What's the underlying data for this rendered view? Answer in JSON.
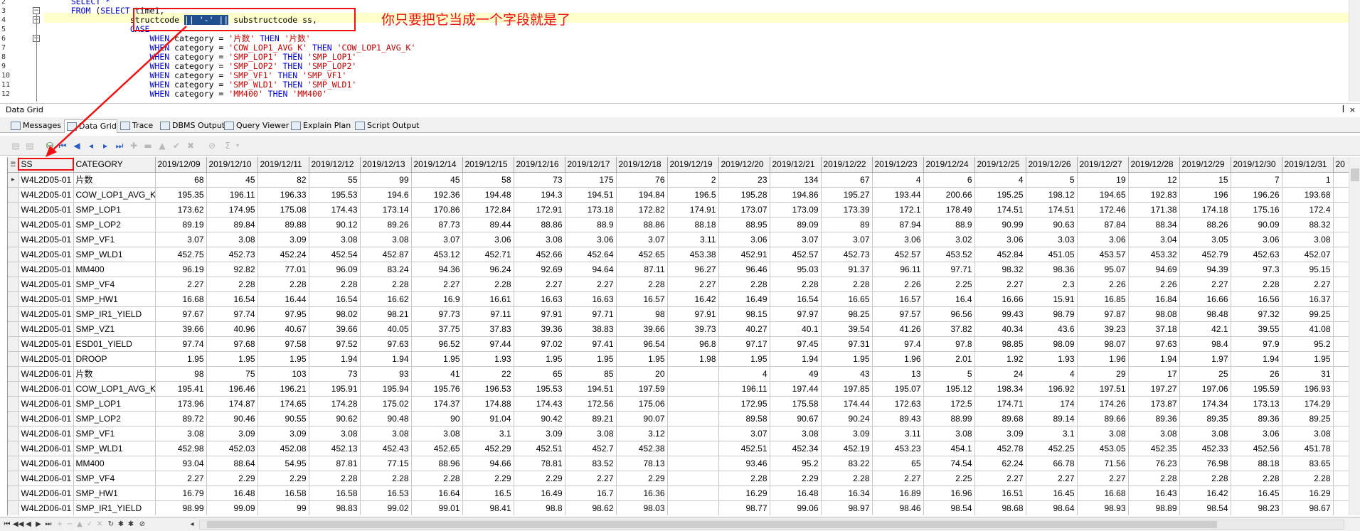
{
  "editor": {
    "lines": [
      "2",
      "3",
      "4",
      "5",
      "6",
      "7",
      "8",
      "9",
      "10",
      "11",
      "12"
    ],
    "code": [
      {
        "indent": "    ",
        "parts": [
          {
            "t": "SELECT *",
            "c": "kw"
          }
        ]
      },
      {
        "indent": "    ",
        "parts": [
          {
            "t": "FROM ",
            "c": "kw"
          },
          {
            "t": "(",
            "c": ""
          },
          {
            "t": "SELECT ",
            "c": "kw"
          },
          {
            "t": "time1,",
            "c": ""
          }
        ]
      },
      {
        "indent": "                ",
        "parts": [
          {
            "t": "structcode ",
            "c": ""
          },
          {
            "t": "|| '-' ||",
            "c": "sel"
          },
          {
            "t": " substructcode ss,",
            "c": ""
          }
        ]
      },
      {
        "indent": "                ",
        "parts": [
          {
            "t": "CASE",
            "c": "kw"
          }
        ]
      },
      {
        "indent": "                    ",
        "parts": [
          {
            "t": "WHEN ",
            "c": "kw"
          },
          {
            "t": "category = ",
            "c": ""
          },
          {
            "t": "'片数'",
            "c": "str"
          },
          {
            "t": " THEN ",
            "c": "kw"
          },
          {
            "t": "'片数'",
            "c": "str"
          }
        ]
      },
      {
        "indent": "                    ",
        "parts": [
          {
            "t": "WHEN ",
            "c": "kw"
          },
          {
            "t": "category = ",
            "c": ""
          },
          {
            "t": "'COW_LOP1_AVG_K'",
            "c": "str"
          },
          {
            "t": " THEN ",
            "c": "kw"
          },
          {
            "t": "'COW_LOP1_AVG_K'",
            "c": "str"
          }
        ]
      },
      {
        "indent": "                    ",
        "parts": [
          {
            "t": "WHEN ",
            "c": "kw"
          },
          {
            "t": "category = ",
            "c": ""
          },
          {
            "t": "'SMP_LOP1'",
            "c": "str"
          },
          {
            "t": " THEN ",
            "c": "kw"
          },
          {
            "t": "'SMP_LOP1'",
            "c": "str"
          }
        ]
      },
      {
        "indent": "                    ",
        "parts": [
          {
            "t": "WHEN ",
            "c": "kw"
          },
          {
            "t": "category = ",
            "c": ""
          },
          {
            "t": "'SMP_LOP2'",
            "c": "str"
          },
          {
            "t": " THEN ",
            "c": "kw"
          },
          {
            "t": "'SMP_LOP2'",
            "c": "str"
          }
        ]
      },
      {
        "indent": "                    ",
        "parts": [
          {
            "t": "WHEN ",
            "c": "kw"
          },
          {
            "t": "category = ",
            "c": ""
          },
          {
            "t": "'SMP_VF1'",
            "c": "str"
          },
          {
            "t": " THEN ",
            "c": "kw"
          },
          {
            "t": "'SMP_VF1'",
            "c": "str"
          }
        ]
      },
      {
        "indent": "                    ",
        "parts": [
          {
            "t": "WHEN ",
            "c": "kw"
          },
          {
            "t": "category = ",
            "c": ""
          },
          {
            "t": "'SMP_WLD1'",
            "c": "str"
          },
          {
            "t": " THEN ",
            "c": "kw"
          },
          {
            "t": "'SMP_WLD1'",
            "c": "str"
          }
        ]
      },
      {
        "indent": "                    ",
        "parts": [
          {
            "t": "WHEN ",
            "c": "kw"
          },
          {
            "t": "category = ",
            "c": ""
          },
          {
            "t": "'MM400'",
            "c": "str"
          },
          {
            "t": " THEN ",
            "c": "kw"
          },
          {
            "t": "'MM400'",
            "c": "str"
          }
        ]
      }
    ],
    "annotation": "你只要把它当成一个字段就是了"
  },
  "panel": {
    "title": "Data Grid",
    "pin": "ꟾ",
    "close": "×"
  },
  "tabs": [
    {
      "label": "Messages",
      "icon": "messages-icon"
    },
    {
      "label": "Data Grid",
      "icon": "grid-icon"
    },
    {
      "label": "Trace",
      "icon": "trace-icon"
    },
    {
      "label": "DBMS Output",
      "icon": "dbms-icon"
    },
    {
      "label": "Query Viewer",
      "icon": "query-icon"
    },
    {
      "label": "Explain Plan",
      "icon": "plan-icon"
    },
    {
      "label": "Script Output",
      "icon": "script-icon"
    }
  ],
  "grid": {
    "columns": [
      "SS",
      "CATEGORY",
      "2019/12/09",
      "2019/12/10",
      "2019/12/11",
      "2019/12/12",
      "2019/12/13",
      "2019/12/14",
      "2019/12/15",
      "2019/12/16",
      "2019/12/17",
      "2019/12/18",
      "2019/12/19",
      "2019/12/20",
      "2019/12/21",
      "2019/12/22",
      "2019/12/23",
      "2019/12/24",
      "2019/12/25",
      "2019/12/26",
      "2019/12/27",
      "2019/12/28",
      "2019/12/29",
      "2019/12/30",
      "2019/12/31",
      "20"
    ],
    "rows": [
      [
        "W4L2D05-01",
        "片数",
        "68",
        "45",
        "82",
        "55",
        "99",
        "45",
        "58",
        "73",
        "175",
        "76",
        "2",
        "23",
        "134",
        "67",
        "4",
        "6",
        "4",
        "5",
        "19",
        "12",
        "15",
        "7",
        "1",
        ""
      ],
      [
        "W4L2D05-01",
        "COW_LOP1_AVG_K",
        "195.35",
        "196.11",
        "196.33",
        "195.53",
        "194.6",
        "192.36",
        "194.48",
        "194.3",
        "194.51",
        "194.84",
        "196.5",
        "195.28",
        "194.86",
        "195.27",
        "193.44",
        "200.66",
        "195.25",
        "198.12",
        "194.65",
        "192.83",
        "196",
        "196.26",
        "193.68",
        ""
      ],
      [
        "W4L2D05-01",
        "SMP_LOP1",
        "173.62",
        "174.95",
        "175.08",
        "174.43",
        "173.14",
        "170.86",
        "172.84",
        "172.91",
        "173.18",
        "172.82",
        "174.91",
        "173.07",
        "173.09",
        "173.39",
        "172.1",
        "178.49",
        "174.51",
        "174.51",
        "172.46",
        "171.38",
        "174.18",
        "175.16",
        "172.4",
        ""
      ],
      [
        "W4L2D05-01",
        "SMP_LOP2",
        "89.19",
        "89.84",
        "89.88",
        "90.12",
        "89.26",
        "87.73",
        "89.44",
        "88.86",
        "88.9",
        "88.86",
        "88.18",
        "88.95",
        "89.09",
        "89",
        "87.94",
        "88.9",
        "90.99",
        "90.63",
        "87.84",
        "88.34",
        "88.26",
        "90.09",
        "88.32",
        ""
      ],
      [
        "W4L2D05-01",
        "SMP_VF1",
        "3.07",
        "3.08",
        "3.09",
        "3.08",
        "3.08",
        "3.07",
        "3.06",
        "3.08",
        "3.06",
        "3.07",
        "3.11",
        "3.06",
        "3.07",
        "3.07",
        "3.06",
        "3.02",
        "3.06",
        "3.03",
        "3.06",
        "3.04",
        "3.05",
        "3.06",
        "3.08",
        ""
      ],
      [
        "W4L2D05-01",
        "SMP_WLD1",
        "452.75",
        "452.73",
        "452.24",
        "452.54",
        "452.87",
        "453.12",
        "452.71",
        "452.66",
        "452.64",
        "452.65",
        "453.38",
        "452.91",
        "452.57",
        "452.73",
        "452.57",
        "453.52",
        "452.84",
        "451.05",
        "453.57",
        "453.32",
        "452.79",
        "452.63",
        "452.07",
        ""
      ],
      [
        "W4L2D05-01",
        "MM400",
        "96.19",
        "92.82",
        "77.01",
        "96.09",
        "83.24",
        "94.36",
        "96.24",
        "92.69",
        "94.64",
        "87.11",
        "96.27",
        "96.46",
        "95.03",
        "91.37",
        "96.11",
        "97.71",
        "98.32",
        "98.36",
        "95.07",
        "94.69",
        "94.39",
        "97.3",
        "95.15",
        ""
      ],
      [
        "W4L2D05-01",
        "SMP_VF4",
        "2.27",
        "2.28",
        "2.28",
        "2.28",
        "2.28",
        "2.27",
        "2.28",
        "2.27",
        "2.27",
        "2.28",
        "2.27",
        "2.28",
        "2.28",
        "2.28",
        "2.26",
        "2.25",
        "2.27",
        "2.3",
        "2.26",
        "2.26",
        "2.27",
        "2.28",
        "2.27",
        ""
      ],
      [
        "W4L2D05-01",
        "SMP_HW1",
        "16.68",
        "16.54",
        "16.44",
        "16.54",
        "16.62",
        "16.9",
        "16.61",
        "16.63",
        "16.63",
        "16.57",
        "16.42",
        "16.49",
        "16.54",
        "16.65",
        "16.57",
        "16.4",
        "16.66",
        "15.91",
        "16.85",
        "16.84",
        "16.66",
        "16.56",
        "16.37",
        ""
      ],
      [
        "W4L2D05-01",
        "SMP_IR1_YIELD",
        "97.67",
        "97.74",
        "97.95",
        "98.02",
        "98.21",
        "97.73",
        "97.11",
        "97.91",
        "97.71",
        "98",
        "97.91",
        "98.15",
        "97.97",
        "98.25",
        "97.57",
        "96.56",
        "99.43",
        "98.79",
        "97.87",
        "98.08",
        "98.48",
        "97.32",
        "99.25",
        ""
      ],
      [
        "W4L2D05-01",
        "SMP_VZ1",
        "39.66",
        "40.96",
        "40.67",
        "39.66",
        "40.05",
        "37.75",
        "37.83",
        "39.36",
        "38.83",
        "39.66",
        "39.73",
        "40.27",
        "40.1",
        "39.54",
        "41.26",
        "37.82",
        "40.34",
        "43.6",
        "39.23",
        "37.18",
        "42.1",
        "39.55",
        "41.08",
        ""
      ],
      [
        "W4L2D05-01",
        "ESD01_YIELD",
        "97.74",
        "97.68",
        "97.58",
        "97.52",
        "97.63",
        "96.52",
        "97.44",
        "97.02",
        "97.41",
        "96.54",
        "96.8",
        "97.17",
        "97.45",
        "97.31",
        "97.4",
        "97.8",
        "98.85",
        "98.09",
        "98.07",
        "97.63",
        "98.4",
        "97.9",
        "95.2",
        ""
      ],
      [
        "W4L2D05-01",
        "DROOP",
        "1.95",
        "1.95",
        "1.95",
        "1.94",
        "1.94",
        "1.95",
        "1.93",
        "1.95",
        "1.95",
        "1.95",
        "1.98",
        "1.95",
        "1.94",
        "1.95",
        "1.96",
        "2.01",
        "1.92",
        "1.93",
        "1.96",
        "1.94",
        "1.97",
        "1.94",
        "1.95",
        ""
      ],
      [
        "W4L2D06-01",
        "片数",
        "98",
        "75",
        "103",
        "73",
        "93",
        "41",
        "22",
        "65",
        "85",
        "20",
        "",
        "4",
        "49",
        "43",
        "13",
        "5",
        "24",
        "4",
        "29",
        "17",
        "25",
        "26",
        "31",
        ""
      ],
      [
        "W4L2D06-01",
        "COW_LOP1_AVG_K",
        "195.41",
        "196.46",
        "196.21",
        "195.91",
        "195.94",
        "195.76",
        "196.53",
        "195.53",
        "194.51",
        "197.59",
        "",
        "196.11",
        "197.44",
        "197.85",
        "195.07",
        "195.12",
        "198.34",
        "196.92",
        "197.51",
        "197.27",
        "197.06",
        "195.59",
        "196.93",
        ""
      ],
      [
        "W4L2D06-01",
        "SMP_LOP1",
        "173.96",
        "174.87",
        "174.65",
        "174.28",
        "175.02",
        "174.37",
        "174.88",
        "174.43",
        "172.56",
        "175.06",
        "",
        "172.95",
        "175.58",
        "174.44",
        "172.63",
        "172.5",
        "174.71",
        "174",
        "174.26",
        "173.87",
        "174.34",
        "173.13",
        "174.29",
        ""
      ],
      [
        "W4L2D06-01",
        "SMP_LOP2",
        "89.72",
        "90.46",
        "90.55",
        "90.62",
        "90.48",
        "90",
        "91.04",
        "90.42",
        "89.21",
        "90.07",
        "",
        "89.58",
        "90.67",
        "90.24",
        "89.43",
        "88.99",
        "89.68",
        "89.14",
        "89.66",
        "89.36",
        "89.35",
        "89.36",
        "89.25",
        ""
      ],
      [
        "W4L2D06-01",
        "SMP_VF1",
        "3.08",
        "3.09",
        "3.09",
        "3.08",
        "3.08",
        "3.08",
        "3.1",
        "3.09",
        "3.08",
        "3.12",
        "",
        "3.07",
        "3.08",
        "3.09",
        "3.11",
        "3.08",
        "3.09",
        "3.1",
        "3.08",
        "3.08",
        "3.08",
        "3.06",
        "3.08",
        ""
      ],
      [
        "W4L2D06-01",
        "SMP_WLD1",
        "452.98",
        "452.03",
        "452.08",
        "452.13",
        "452.43",
        "452.65",
        "452.29",
        "452.51",
        "452.7",
        "452.38",
        "",
        "452.51",
        "452.34",
        "452.19",
        "453.23",
        "454.1",
        "452.78",
        "452.25",
        "453.05",
        "452.35",
        "452.33",
        "452.56",
        "451.78",
        ""
      ],
      [
        "W4L2D06-01",
        "MM400",
        "93.04",
        "88.64",
        "54.95",
        "87.81",
        "77.15",
        "88.96",
        "94.66",
        "78.81",
        "83.52",
        "78.13",
        "",
        "93.46",
        "95.2",
        "83.22",
        "65",
        "74.54",
        "62.24",
        "66.78",
        "71.56",
        "76.23",
        "76.98",
        "88.18",
        "83.65",
        ""
      ],
      [
        "W4L2D06-01",
        "SMP_VF4",
        "2.27",
        "2.29",
        "2.29",
        "2.28",
        "2.28",
        "2.28",
        "2.29",
        "2.29",
        "2.27",
        "2.29",
        "",
        "2.28",
        "2.29",
        "2.28",
        "2.27",
        "2.25",
        "2.27",
        "2.27",
        "2.27",
        "2.28",
        "2.28",
        "2.28",
        "2.28",
        ""
      ],
      [
        "W4L2D06-01",
        "SMP_HW1",
        "16.79",
        "16.48",
        "16.58",
        "16.58",
        "16.53",
        "16.64",
        "16.5",
        "16.49",
        "16.7",
        "16.36",
        "",
        "16.29",
        "16.48",
        "16.34",
        "16.89",
        "16.96",
        "16.51",
        "16.45",
        "16.68",
        "16.43",
        "16.42",
        "16.45",
        "16.29",
        ""
      ],
      [
        "W4L2D06-01",
        "SMP_IR1_YIELD",
        "98.99",
        "99.09",
        "99",
        "98.83",
        "99.02",
        "99.01",
        "98.41",
        "98.8",
        "98.62",
        "98.03",
        "",
        "98.77",
        "99.06",
        "98.97",
        "98.46",
        "98.54",
        "98.68",
        "98.64",
        "98.93",
        "98.89",
        "98.54",
        "98.23",
        "98.67",
        ""
      ]
    ]
  }
}
